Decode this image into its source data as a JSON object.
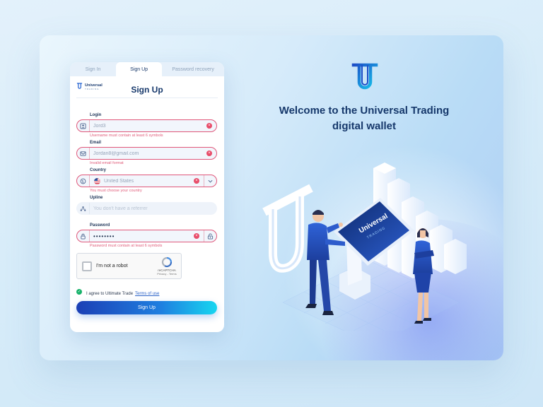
{
  "tabs": [
    {
      "label": "Sign In",
      "active": false
    },
    {
      "label": "Sign Up",
      "active": true
    },
    {
      "label": "Password recovery",
      "active": false
    }
  ],
  "brand": {
    "name": "Universal",
    "sub": "TRADING"
  },
  "form": {
    "title": "Sign Up",
    "login": {
      "label": "Login",
      "value": "Jord3",
      "error": "Username must contain at least 6 symbols"
    },
    "email": {
      "label": "Email",
      "value": "Jordan8@gmail.com",
      "error": "Invalid email format"
    },
    "country": {
      "label": "Country",
      "value": "United States",
      "error": "You must choose your country"
    },
    "upline": {
      "label": "Upline",
      "placeholder": "You don't have a referrer"
    },
    "password": {
      "label": "Password",
      "value": "••••••••",
      "error": "Password must contain at least 6 symbols"
    },
    "captcha": {
      "label": "I'm not a robot",
      "brand": "reCAPTCHA",
      "links": "Privacy - Terms"
    },
    "agree": {
      "text": "I agree to Ultimate Trade",
      "link": "Terms of use",
      "checked": true
    },
    "submit": "Sign Up"
  },
  "hero": {
    "line1": "Welcome to the Universal Trading",
    "line2": "digital wallet",
    "kiosk_brand": "Universal",
    "kiosk_sub": "TRADING"
  },
  "colors": {
    "primary": "#16386b",
    "error": "#e0577a",
    "gradient_start": "#1c3fb5",
    "gradient_end": "#17d6f0",
    "success": "#17b26a"
  },
  "icons": [
    "user-icon",
    "mail-icon",
    "globe-icon",
    "network-icon",
    "lock-icon",
    "clear-icon",
    "chevron-down-icon",
    "key-lock-icon",
    "check-icon",
    "recaptcha-icon"
  ]
}
